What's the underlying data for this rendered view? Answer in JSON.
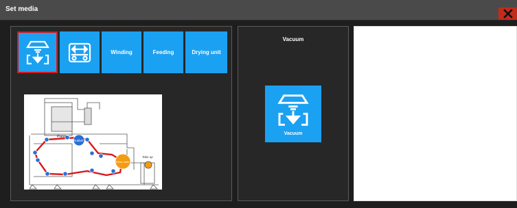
{
  "window": {
    "title": "Set media"
  },
  "tiles": [
    {
      "label": "",
      "icon": "vacuum-icon"
    },
    {
      "label": "",
      "icon": "media-width-icon"
    },
    {
      "label": "Winding"
    },
    {
      "label": "Feeding"
    },
    {
      "label": "Drying unit"
    }
  ],
  "diagram": {
    "labels": {
      "platen": "Platen",
      "rubber": "Rubber",
      "drive_roller": "Drive roller",
      "take_up": "Take up"
    }
  },
  "vacuum_panel": {
    "heading": "Vacuum",
    "button_label": "Vacuum"
  },
  "colors": {
    "accent": "#1ba1f2",
    "selected_border": "#d7191c",
    "close": "#c42b1c"
  }
}
